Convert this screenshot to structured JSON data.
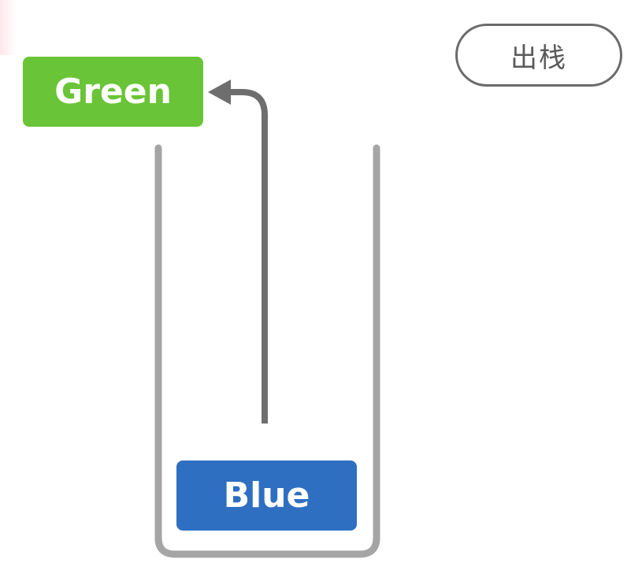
{
  "operation": {
    "label": "出栈"
  },
  "stack": {
    "popped_item": "Green",
    "remaining_items": [
      "Blue"
    ]
  },
  "colors": {
    "popped_block": "#6ac437",
    "stack_block": "#2e6fc2",
    "container": "#a5a5a5",
    "arrow": "#6e6e6e",
    "button_border": "#6b6b6b",
    "button_text": "#5a5a5a"
  },
  "icons": {
    "move_arrow": "arrow-up-then-left-icon"
  }
}
